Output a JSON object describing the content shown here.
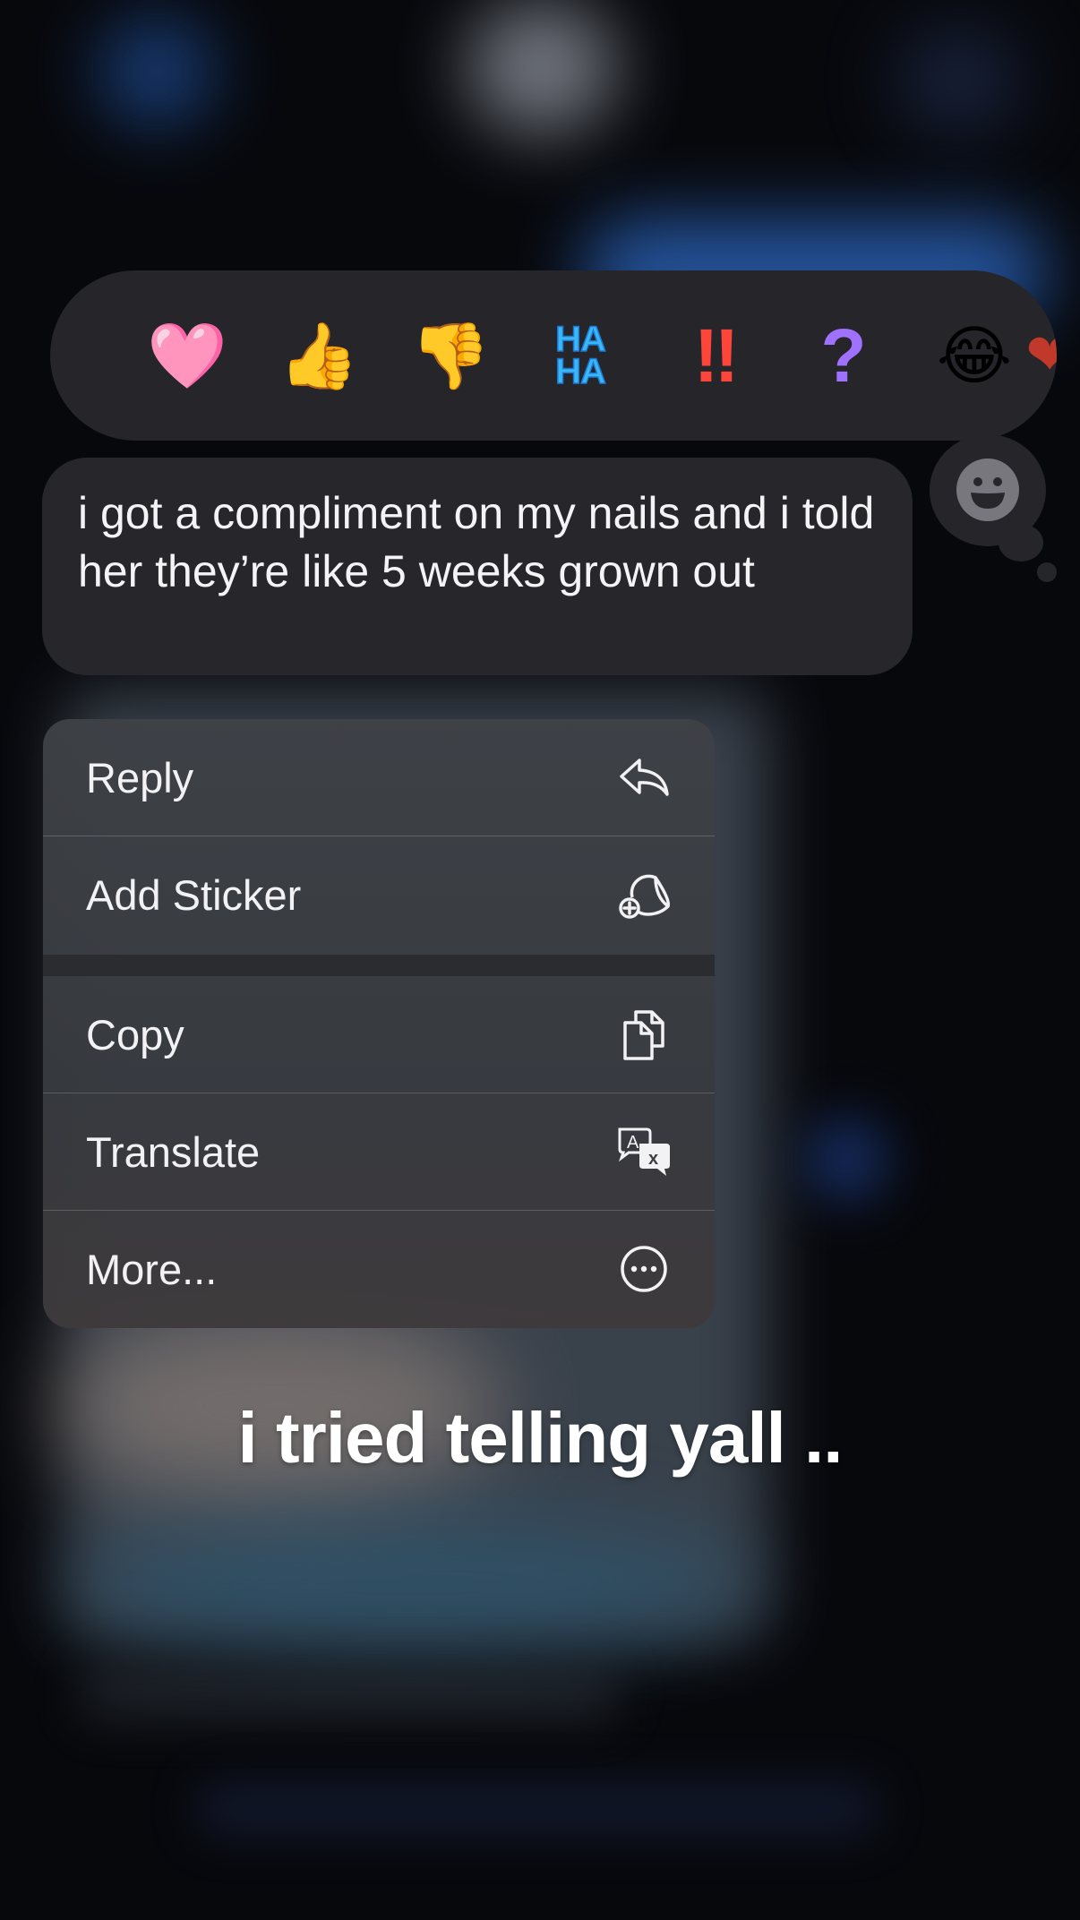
{
  "reactions": [
    {
      "name": "heart",
      "glyph": "🩷"
    },
    {
      "name": "thumbs-up",
      "glyph": "👍"
    },
    {
      "name": "thumbs-down",
      "glyph": "👎"
    },
    {
      "name": "haha",
      "glyph": "HA\nHA"
    },
    {
      "name": "exclamation",
      "glyph": "‼"
    },
    {
      "name": "question",
      "glyph": "?"
    },
    {
      "name": "laughing",
      "glyph": "😂"
    },
    {
      "name": "heart-partial",
      "glyph": "❤"
    }
  ],
  "add_reaction": {
    "icon": "smiley-icon"
  },
  "message": {
    "text": "i got a compliment on my nails and i told her they’re like 5 weeks grown out"
  },
  "menu": {
    "items": [
      {
        "label": "Reply",
        "icon": "reply-icon"
      },
      {
        "label": "Add Sticker",
        "icon": "add-sticker-icon"
      },
      {
        "label": "Copy",
        "icon": "copy-icon"
      },
      {
        "label": "Translate",
        "icon": "translate-icon"
      },
      {
        "label": "More...",
        "icon": "more-icon"
      }
    ]
  },
  "caption": "i tried telling yall ..",
  "colors": {
    "background": "#07080c",
    "bubble": "#26262b",
    "reaction_bar": "#25252a",
    "menu": "#3c3f44",
    "text": "#f4f4f6"
  }
}
